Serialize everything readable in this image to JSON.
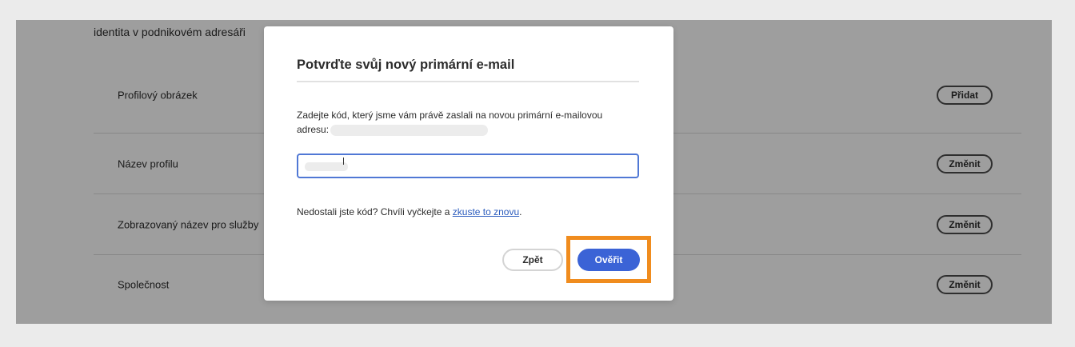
{
  "background": {
    "intro_text": "identita v podnikovém adresáři",
    "rows": [
      {
        "label": "Profilový obrázek",
        "button": "Přidat"
      },
      {
        "label": "Název profilu",
        "button": "Změnit"
      },
      {
        "label": "Zobrazovaný název pro služby",
        "button": "Změnit"
      },
      {
        "label": "Společnost",
        "button": "Změnit"
      }
    ]
  },
  "dialog": {
    "title": "Potvrďte svůj nový primární e-mail",
    "instruction": "Zadejte kód, který jsme vám právě zaslali na novou primární e-mailovou adresu:",
    "code_input": {
      "value": "",
      "placeholder": ""
    },
    "resend_prefix": "Nedostali jste kód? Chvíli vyčkejte a ",
    "resend_link": "zkuste to znovu",
    "resend_suffix": ".",
    "back_button": "Zpět",
    "verify_button": "Ověřit"
  },
  "colors": {
    "primary": "#3b63d6",
    "highlight": "#f08c1e",
    "link": "#2a5bbd"
  }
}
